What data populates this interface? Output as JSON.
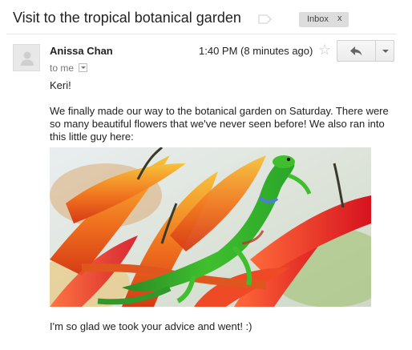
{
  "message": {
    "subject": "Visit to the tropical botanical garden",
    "label": "Inbox",
    "label_remove": "x",
    "sender_name": "Anissa Chan",
    "recipient": "to me",
    "timestamp": "1:40 PM (8 minutes ago)",
    "starred": false,
    "body": {
      "greeting": "Keri!",
      "paragraph": "We finally made our way to the botanical garden on Saturday. There were so many beautiful flowers that we've never seen before! We also ran into this little guy here:",
      "closing": "I'm so glad we took your advice and went! :)"
    },
    "attachment_image": "photo of a green gecko on orange heliconia flowers"
  },
  "icons": {
    "important": "important-marker-icon",
    "avatar": "person-silhouette-icon",
    "star": "star-outline-icon",
    "reply": "reply-arrow-icon",
    "more": "chevron-down-icon"
  },
  "colors": {
    "label_chip": "#dddddd",
    "muted_text": "#777777",
    "star_outline": "#c6c6c6"
  }
}
